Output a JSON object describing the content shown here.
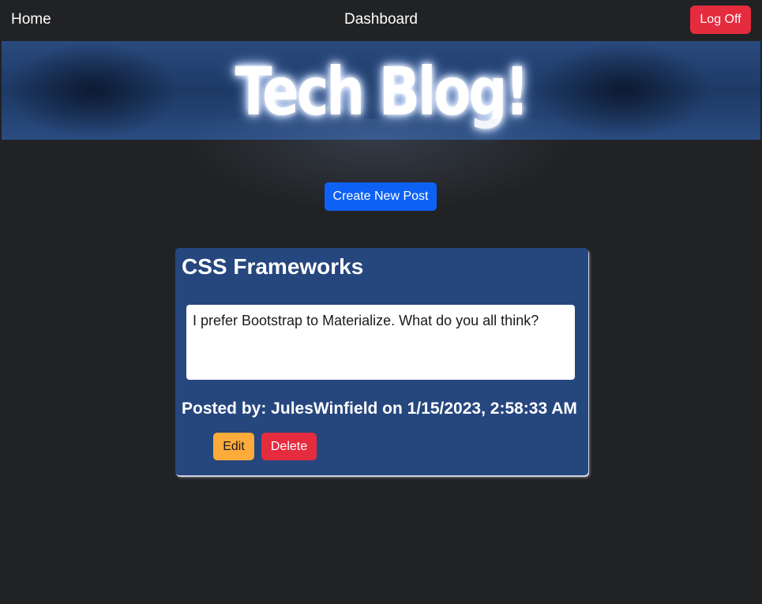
{
  "nav": {
    "home_label": "Home",
    "dashboard_label": "Dashboard",
    "logoff_label": "Log Off"
  },
  "banner": {
    "title": "Tech Blog!"
  },
  "actions": {
    "create_post_label": "Create New Post"
  },
  "post": {
    "title": "CSS Frameworks",
    "body": "I prefer Bootstrap to Materialize. What do you all think?",
    "meta": "Posted by: JulesWinfield on 1/15/2023, 2:58:33 AM",
    "edit_label": "Edit",
    "delete_label": "Delete"
  },
  "colors": {
    "background": "#212224",
    "banner": "#26467e",
    "card": "#26467e",
    "primary_button": "#0d62f5",
    "danger_button": "#e52b3e",
    "warning_button": "#fdab3b"
  }
}
